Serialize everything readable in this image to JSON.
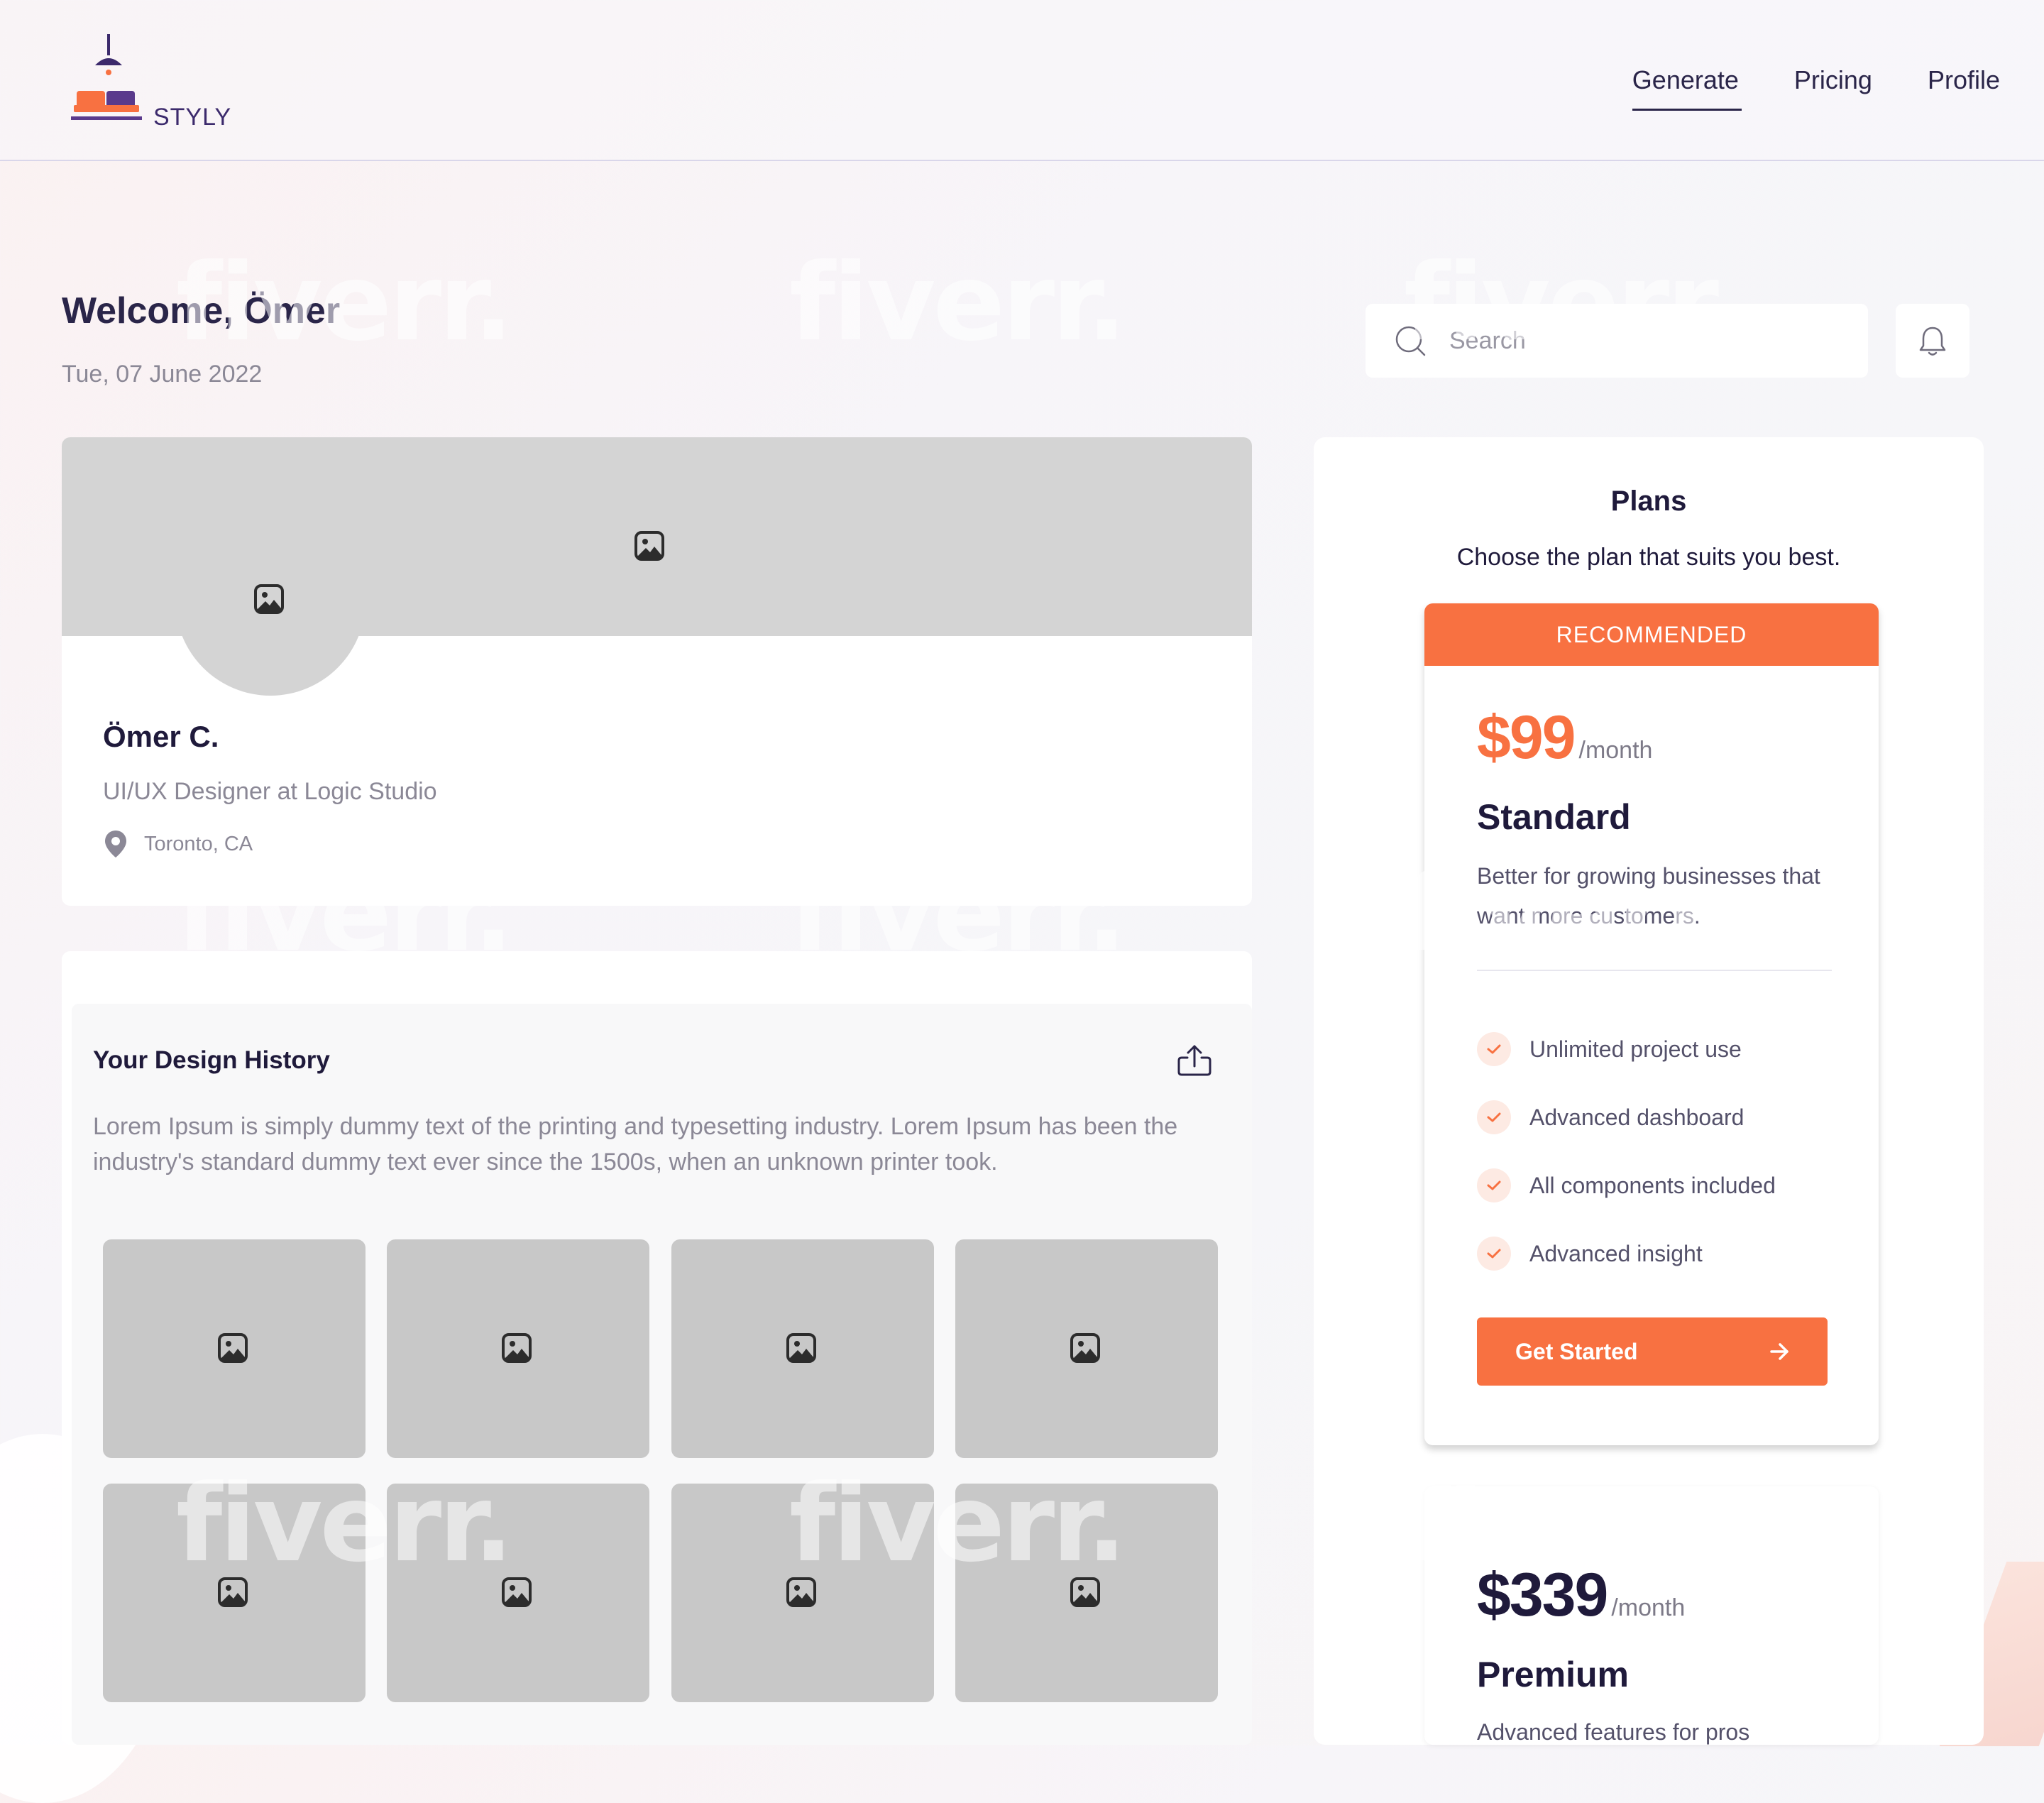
{
  "colors": {
    "accent": "#f87141",
    "navy": "#1f1a3b",
    "muted": "#8b8896",
    "placeholder_gray": "#d4d4d4"
  },
  "header": {
    "logo_text": "STYLY",
    "nav": [
      {
        "label": "Generate",
        "active": true
      },
      {
        "label": "Pricing",
        "active": false
      },
      {
        "label": "Profile",
        "active": false
      }
    ]
  },
  "welcome": {
    "title": "Welcome, Ömer",
    "date": "Tue, 07 June 2022"
  },
  "search": {
    "placeholder": "Search",
    "icon": "search-icon"
  },
  "notifications": {
    "icon": "bell-icon"
  },
  "profile": {
    "name": "Ömer C.",
    "role": "UI/UX Designer at Logic Studio",
    "location": "Toronto, CA",
    "location_icon": "map-pin-icon"
  },
  "history": {
    "title": "Your Design History",
    "description": "Lorem Ipsum is simply dummy text of the printing and typesetting industry. Lorem Ipsum has been the industry's standard dummy text ever since the 1500s, when an unknown printer took.",
    "upload_icon": "upload-icon",
    "thumbnail_count": 8
  },
  "plans": {
    "title": "Plans",
    "subtitle": "Choose the plan that suits you best.",
    "standard": {
      "badge": "RECOMMENDED",
      "price": "$99",
      "period": "/month",
      "name": "Standard",
      "description": "Better for growing businesses that want more customers.",
      "features": [
        "Unlimited project use",
        "Advanced dashboard",
        "All components included",
        "Advanced insight"
      ],
      "cta": "Get Started"
    },
    "premium": {
      "price": "$339",
      "period": "/month",
      "name": "Premium",
      "description": "Advanced features for pros"
    }
  },
  "watermark": "fiverr."
}
